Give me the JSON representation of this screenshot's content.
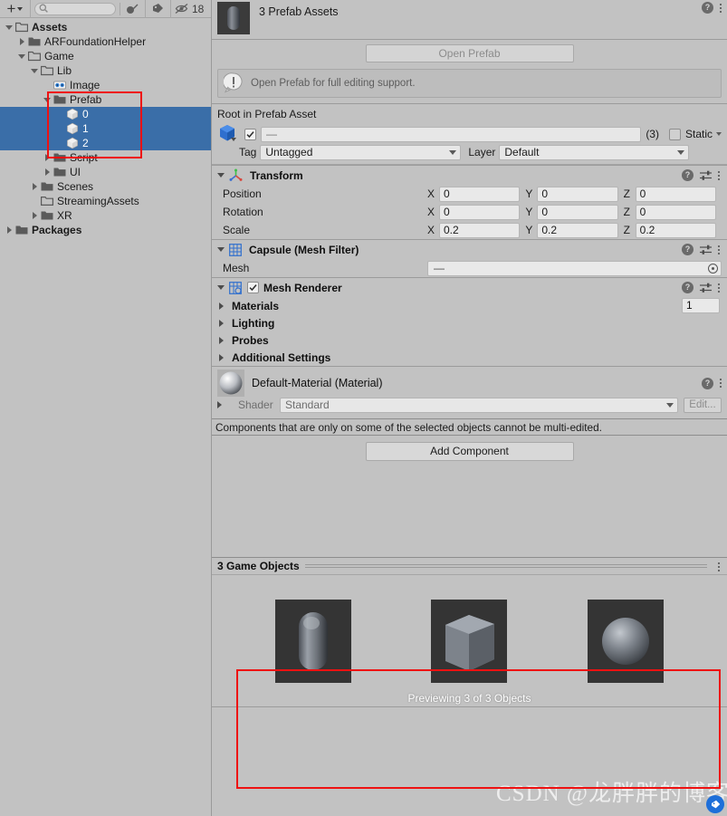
{
  "hierarchy": {
    "toolbar": {
      "create_label": "+",
      "search_placeholder": "",
      "search_value": "",
      "icons": [
        "paint-icon",
        "tag-icon",
        "hidden-objects-icon"
      ],
      "hidden_count": "18"
    },
    "tree": [
      {
        "label": "Assets",
        "depth": 0,
        "arrow": "down",
        "icon": "folder-open-icon",
        "bold": true,
        "selected": false
      },
      {
        "label": "ARFoundationHelper",
        "depth": 1,
        "arrow": "right",
        "icon": "folder-icon",
        "bold": false,
        "selected": false
      },
      {
        "label": "Game",
        "depth": 1,
        "arrow": "down",
        "icon": "folder-open-icon",
        "bold": false,
        "selected": false
      },
      {
        "label": "Lib",
        "depth": 2,
        "arrow": "down",
        "icon": "folder-open-icon",
        "bold": false,
        "selected": false
      },
      {
        "label": "Image",
        "depth": 3,
        "arrow": "none",
        "icon": "sprite-atlas-icon",
        "bold": false,
        "selected": false
      },
      {
        "label": "Prefab",
        "depth": 3,
        "arrow": "down",
        "icon": "folder-icon",
        "bold": false,
        "selected": false
      },
      {
        "label": "0",
        "depth": 4,
        "arrow": "none",
        "icon": "prefab-icon",
        "bold": false,
        "selected": true
      },
      {
        "label": "1",
        "depth": 4,
        "arrow": "none",
        "icon": "prefab-icon",
        "bold": false,
        "selected": true
      },
      {
        "label": "2",
        "depth": 4,
        "arrow": "none",
        "icon": "prefab-icon",
        "bold": false,
        "selected": true
      },
      {
        "label": "Script",
        "depth": 3,
        "arrow": "right",
        "icon": "folder-icon",
        "bold": false,
        "selected": false
      },
      {
        "label": "UI",
        "depth": 3,
        "arrow": "right",
        "icon": "folder-icon",
        "bold": false,
        "selected": false
      },
      {
        "label": "Scenes",
        "depth": 2,
        "arrow": "right",
        "icon": "folder-icon",
        "bold": false,
        "selected": false
      },
      {
        "label": "StreamingAssets",
        "depth": 2,
        "arrow": "none",
        "icon": "folder-empty-icon",
        "bold": false,
        "selected": false
      },
      {
        "label": "XR",
        "depth": 2,
        "arrow": "right",
        "icon": "folder-icon",
        "bold": false,
        "selected": false
      },
      {
        "label": "Packages",
        "depth": 0,
        "arrow": "right",
        "icon": "folder-icon",
        "bold": true,
        "selected": false
      }
    ]
  },
  "inspector": {
    "header": {
      "title": "3 Prefab Assets",
      "thumb": "capsule-preview-icon"
    },
    "open_prefab_button": "Open Prefab",
    "helpbox": {
      "icon": "warning-icon",
      "message": "Open Prefab for full editing support."
    },
    "root_section_label": "Root in Prefab Asset",
    "game_object": {
      "enabled": true,
      "name_value": "—",
      "count_label": "(3)",
      "static_label": "Static",
      "static_checked": false,
      "tag_label": "Tag",
      "tag_value": "Untagged",
      "layer_label": "Layer",
      "layer_value": "Default"
    },
    "components": [
      {
        "name": "Transform",
        "icon": "transform-gizmo-icon",
        "expanded": true,
        "rows": [
          {
            "label": "Position",
            "x": "0",
            "y": "0",
            "z": "0"
          },
          {
            "label": "Rotation",
            "x": "0",
            "y": "0",
            "z": "0"
          },
          {
            "label": "Scale",
            "x": "0.2",
            "y": "0.2",
            "z": "0.2"
          }
        ]
      }
    ],
    "mesh_filter": {
      "name": "Capsule (Mesh Filter)",
      "icon": "mesh-filter-icon",
      "mesh_label": "Mesh",
      "mesh_value": "—"
    },
    "mesh_renderer": {
      "name": "Mesh Renderer",
      "icon": "mesh-renderer-icon",
      "enabled": true,
      "materials_label": "Materials",
      "materials_count": "1",
      "foldouts": [
        "Lighting",
        "Probes",
        "Additional Settings"
      ]
    },
    "material": {
      "title": "Default-Material (Material)",
      "shader_label": "Shader",
      "shader_value": "Standard",
      "edit_button": "Edit..."
    },
    "multi_edit_note": "Components that are only on some of the selected objects cannot be multi-edited.",
    "add_component_button": "Add Component",
    "preview": {
      "title": "3 Game Objects",
      "caption": "Previewing 3 of 3 Objects",
      "thumbs": [
        "capsule-preview",
        "cube-preview",
        "sphere-preview"
      ]
    }
  },
  "watermark": {
    "text": "CSDN @龙胖胖的博客"
  },
  "colors": {
    "panel_bg": "#c2c2c2",
    "selection_blue": "#3a6ea8",
    "annotation_red": "#ee1111",
    "field_bg": "#e9e9e9"
  }
}
